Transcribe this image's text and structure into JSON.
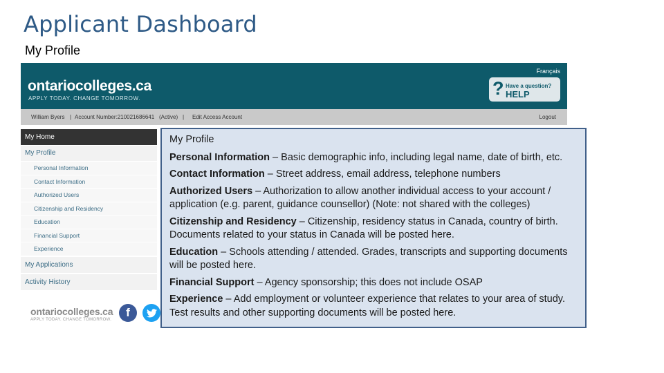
{
  "slide": {
    "title": "Applicant Dashboard",
    "subtitle": "My Profile"
  },
  "screenshot": {
    "language_link": "Français",
    "brand_name": "ontariocolleges.ca",
    "brand_tagline": "APPLY TODAY. CHANGE TOMORROW.",
    "help": {
      "small_text": "Have a question?",
      "big_text": "HELP",
      "icon": "question-mark-icon"
    },
    "account_bar": {
      "user_name": "William Byers",
      "account_number": "Account Number:210021686641",
      "status": "(Active)",
      "separator": "|",
      "edit_link": "Edit Access Account",
      "logout": "Logout"
    },
    "nav": {
      "home": "My Home",
      "profile": "My Profile",
      "profile_items": [
        "Personal Information",
        "Contact Information",
        "Authorized Users",
        "Citizenship and Residency",
        "Education",
        "Financial Support",
        "Experience"
      ],
      "applications": "My Applications",
      "activity": "Activity History"
    },
    "footer": {
      "brand": "ontariocolleges.ca",
      "tagline": "APPLY TODAY. CHANGE TOMORROW.",
      "facebook_icon": "facebook-icon",
      "twitter_icon": "twitter-icon"
    }
  },
  "callout": {
    "heading": "My Profile",
    "entries": [
      {
        "term": "Personal Information",
        "desc": " – Basic demographic info, including legal name, date of birth, etc."
      },
      {
        "term": "Contact Information",
        "desc": " – Street address, email address, telephone numbers"
      },
      {
        "term": "Authorized Users",
        "desc": " – Authorization to allow another individual access to your account / application (e.g. parent, guidance counsellor) (Note: not shared with the colleges)"
      },
      {
        "term": "Citizenship and Residency",
        "desc": " – Citizenship, residency status in Canada, country of birth.",
        "extra": "Documents related to your status in Canada will be posted here."
      },
      {
        "term": "Education",
        "desc": " – Schools attending / attended. Grades, transcripts and supporting documents will be posted here."
      },
      {
        "term": "Financial Support",
        "desc": " – Agency sponsorship; this does not include OSAP"
      },
      {
        "term": "Experience",
        "desc": " – Add employment or volunteer experience that relates to your area of study. Test results and other supporting documents will be posted here."
      }
    ]
  },
  "colors": {
    "title": "#2e5a86",
    "header_bg": "#0e5a6a",
    "callout_bg": "#dae3ef",
    "callout_border": "#41608a"
  }
}
